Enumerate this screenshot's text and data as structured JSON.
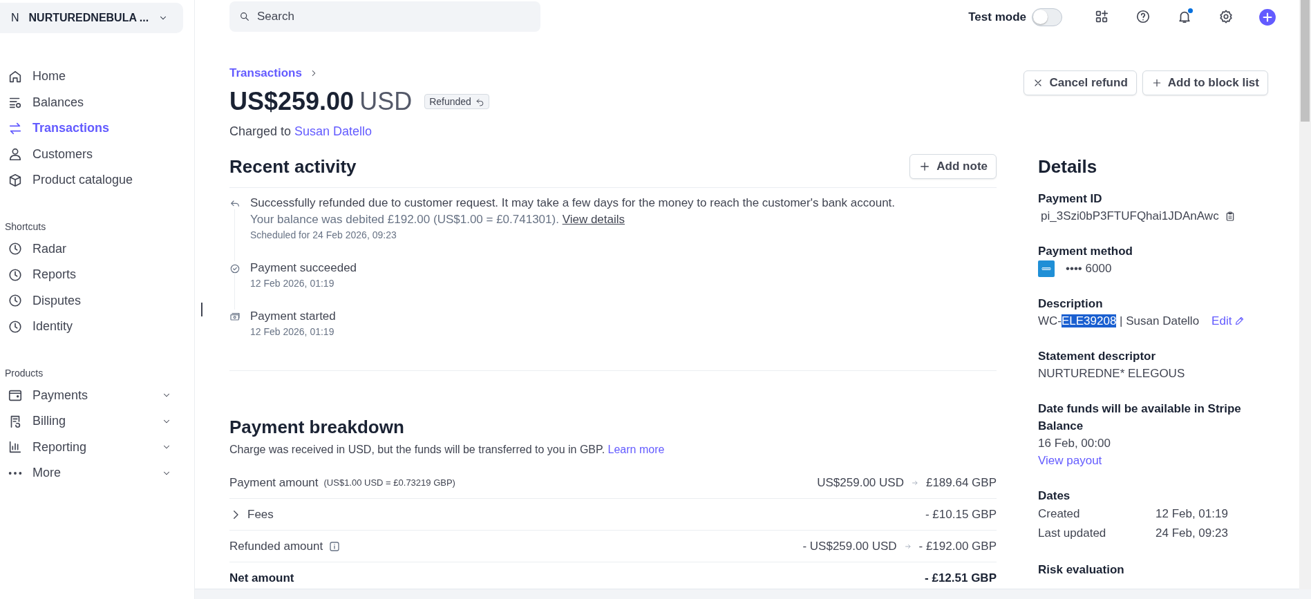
{
  "account": {
    "initial": "N",
    "name": "NURTUREDNEBULA ..."
  },
  "nav": [
    {
      "label": "Home",
      "selected": false
    },
    {
      "label": "Balances",
      "selected": false
    },
    {
      "label": "Transactions",
      "selected": true
    },
    {
      "label": "Customers",
      "selected": false
    },
    {
      "label": "Product catalogue",
      "selected": false
    }
  ],
  "shortcuts": {
    "title": "Shortcuts",
    "items": [
      {
        "label": "Radar"
      },
      {
        "label": "Reports"
      },
      {
        "label": "Disputes"
      },
      {
        "label": "Identity"
      }
    ]
  },
  "products": {
    "title": "Products",
    "items": [
      {
        "label": "Payments",
        "expanded": false
      },
      {
        "label": "Billing",
        "expanded": false
      },
      {
        "label": "Reporting",
        "expanded": false
      },
      {
        "label": "More",
        "expanded": false
      }
    ]
  },
  "search": {
    "placeholder": "Search"
  },
  "test_mode": {
    "label": "Test mode",
    "on": false
  },
  "notifications": {
    "unread": true
  },
  "breadcrumb": {
    "label": "Transactions"
  },
  "amount": {
    "value": "US$259.00",
    "currency": "USD",
    "status": "Refunded"
  },
  "charged_to": {
    "prefix": "Charged to",
    "customer": "Susan Datello"
  },
  "actions": [
    {
      "kind": "cancel",
      "label": "Cancel refund"
    },
    {
      "kind": "add",
      "label": "Add to block list"
    }
  ],
  "recent_activity": {
    "title": "Recent activity",
    "add_note": "Add note",
    "events": [
      {
        "kind": "refund",
        "text": "Successfully refunded due to customer request. It may take a few days for the money to reach the customer's bank account.",
        "detail": "Your balance was debited £192.00 (US$1.00 = £0.741301).",
        "link": "View details",
        "time": "Scheduled for 24 Feb 2026, 09:23"
      },
      {
        "kind": "succeeded",
        "text": "Payment succeeded",
        "time": "12 Feb 2026, 01:19"
      },
      {
        "kind": "started",
        "text": "Payment started",
        "time": "12 Feb 2026, 01:19"
      }
    ]
  },
  "breakdown": {
    "title": "Payment breakdown",
    "note": "Charge was received in USD, but the funds will be transferred to you in GBP.",
    "link": "Learn more",
    "rows": [
      {
        "kind": "rate",
        "label": "Payment amount",
        "rate": "(US$1.00 USD = £0.73219 GBP)",
        "from": "US$259.00 USD",
        "to": "£189.64 GBP"
      },
      {
        "kind": "expandable",
        "label": "Fees",
        "expanded": false,
        "to": "- £10.15 GBP"
      },
      {
        "kind": "info",
        "label": "Refunded amount",
        "from": "- US$259.00 USD",
        "to": "- £192.00 GBP"
      },
      {
        "kind": "total",
        "label": "Net amount",
        "to": "- £12.51 GBP"
      }
    ]
  },
  "details": {
    "title": "Details",
    "payment_id": {
      "label": "Payment ID",
      "value": "pi_3Szi0bP3FTUFQhai1JDAnAwc"
    },
    "payment_method": {
      "label": "Payment method",
      "number": "•••• 6000"
    },
    "description": {
      "label": "Description",
      "parts": [
        {
          "text": "WC-",
          "selected": false
        },
        {
          "text": "ELE39208",
          "selected": true
        },
        {
          "text": " | Susan Datello",
          "selected": false
        }
      ],
      "edit": "Edit"
    },
    "statement_descriptor": {
      "label": "Statement descriptor",
      "value": "NURTUREDNE* ELEGOUS"
    },
    "funds": {
      "label": "Date funds will be available in Stripe Balance",
      "value": "16 Feb, 00:00",
      "link": "View payout"
    },
    "dates": {
      "label": "Dates",
      "rows": [
        {
          "name": "Created",
          "value": "12 Feb, 01:19"
        },
        {
          "name": "Last updated",
          "value": "24 Feb, 09:23"
        }
      ]
    },
    "risk": {
      "label": "Risk evaluation"
    }
  }
}
